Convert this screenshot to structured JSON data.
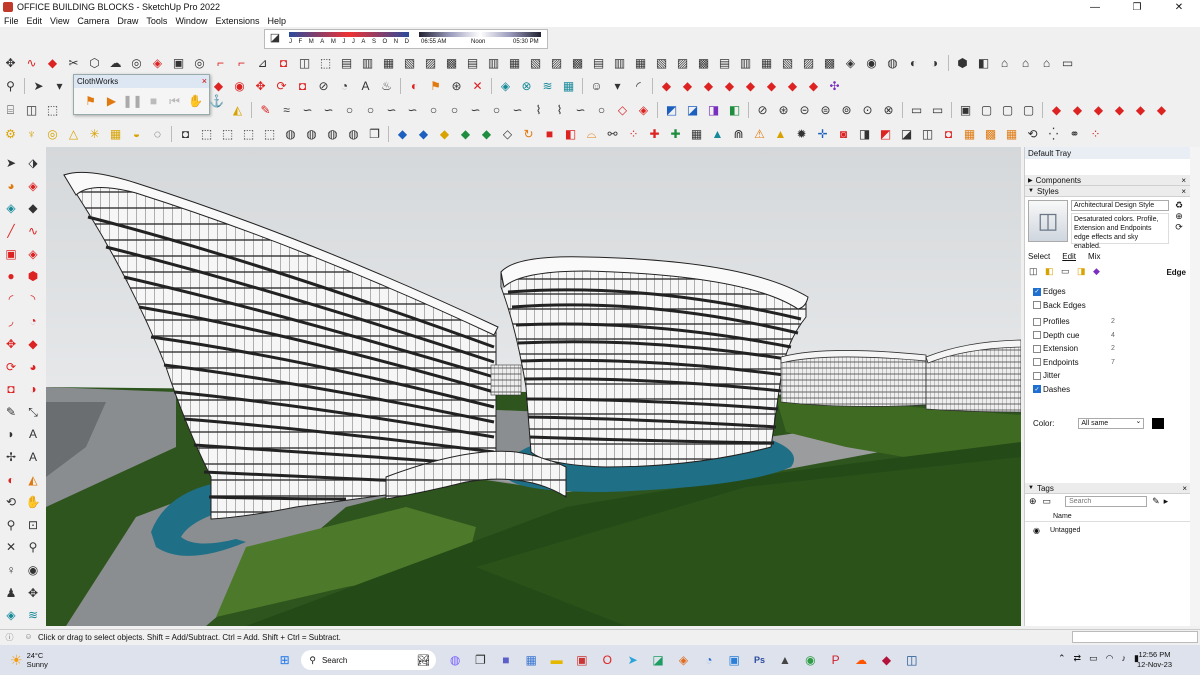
{
  "window": {
    "title": "OFFICE BUILDING BLOCKS - SketchUp Pro 2022",
    "minimize_glyph": "—",
    "maximize_glyph": "❐",
    "close_glyph": "✕"
  },
  "menu": [
    "File",
    "Edit",
    "View",
    "Camera",
    "Draw",
    "Tools",
    "Window",
    "Extensions",
    "Help"
  ],
  "shadow_bar": {
    "months": [
      "J",
      "F",
      "M",
      "A",
      "M",
      "J",
      "J",
      "A",
      "S",
      "O",
      "N",
      "D"
    ],
    "time_start": "06:55 AM",
    "time_mid": "Noon",
    "time_end": "05:30 PM"
  },
  "clothworks": {
    "title": "ClothWorks",
    "close_glyph": "×"
  },
  "tray": {
    "title": "Default Tray",
    "components_label": "Components",
    "styles_label": "Styles",
    "style_name": "Architectural Design Style",
    "style_description": "Desaturated colors. Profile, Extension and Endpoints edge effects and sky enabled.",
    "tabs": [
      "Select",
      "Edit",
      "Mix"
    ],
    "edge_label": "Edge",
    "edge_options": [
      {
        "label": "Edges",
        "checked": true,
        "value": ""
      },
      {
        "label": "Back Edges",
        "checked": false,
        "value": ""
      },
      {
        "label": "Profiles",
        "checked": false,
        "value": "2"
      },
      {
        "label": "Depth cue",
        "checked": false,
        "value": "4"
      },
      {
        "label": "Extension",
        "checked": false,
        "value": "2"
      },
      {
        "label": "Endpoints",
        "checked": false,
        "value": "7"
      },
      {
        "label": "Jitter",
        "checked": false,
        "value": ""
      },
      {
        "label": "Dashes",
        "checked": true,
        "value": ""
      }
    ],
    "color_label": "Color:",
    "color_value": "All same",
    "color_swatch": "#000000",
    "tags_label": "Tags",
    "tags_search_placeholder": "Search",
    "tags_column": "Name",
    "tags": [
      "Untagged"
    ]
  },
  "status": {
    "message": "Click or drag to select objects. Shift = Add/Subtract. Ctrl = Add. Shift + Ctrl = Subtract."
  },
  "taskbar": {
    "temperature": "24°C",
    "condition": "Sunny",
    "search_placeholder": "Search",
    "time": "12:56 PM",
    "date": "12-Nov-23"
  },
  "colors": {
    "sky": "#d9dcde",
    "grass": "#2f5a1e",
    "water": "#1f6f86",
    "paving": "#8a8d90",
    "building": "#f4f4f4"
  }
}
